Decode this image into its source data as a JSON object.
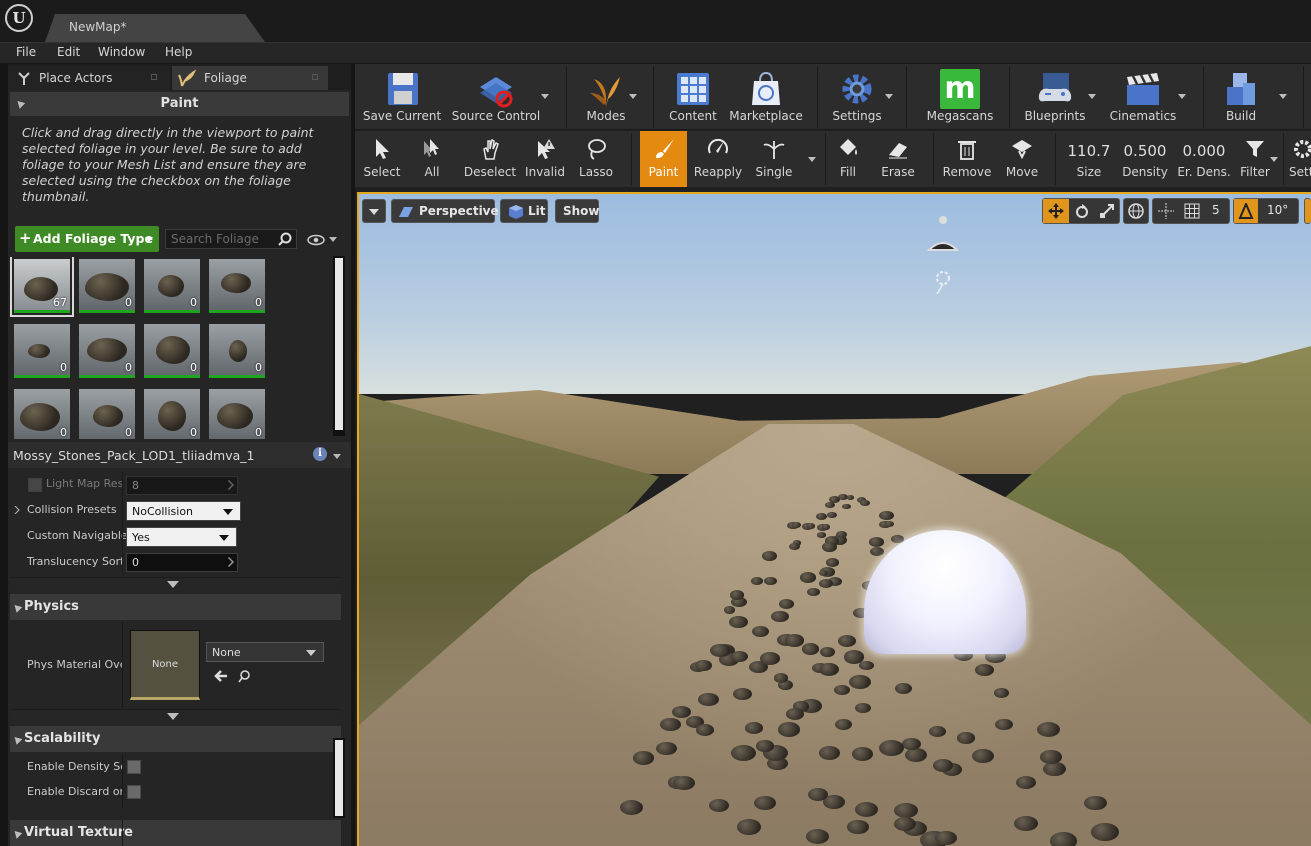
{
  "window": {
    "tab_title": "NewMap*"
  },
  "menu": {
    "file": "File",
    "edit": "Edit",
    "window": "Window",
    "help": "Help"
  },
  "left_tabs": {
    "place_actors": "Place Actors",
    "foliage": "Foliage"
  },
  "paint": {
    "header": "Paint",
    "help": "Click and drag directly in the viewport to paint selected foliage in your level. Be sure to add foliage to your Mesh List and ensure they are selected using the checkbox on the foliage thumbnail."
  },
  "foliage_list": {
    "add_button": "Add Foliage Type",
    "search_placeholder": "Search Foliage",
    "thumbnails": [
      {
        "count": "67"
      },
      {
        "count": "0"
      },
      {
        "count": "0"
      },
      {
        "count": "0"
      },
      {
        "count": "0"
      },
      {
        "count": "0"
      },
      {
        "count": "0"
      },
      {
        "count": "0"
      },
      {
        "count": "0"
      },
      {
        "count": "0"
      },
      {
        "count": "0"
      },
      {
        "count": "0"
      }
    ]
  },
  "details": {
    "object_name": "Mossy_Stones_Pack_LOD1_tliiadmva_1",
    "light_map_label": "Light Map Reso",
    "light_map_value": "8",
    "collision_label": "Collision Presets",
    "collision_value": "NoCollision",
    "navigable_label": "Custom Navigable",
    "navigable_value": "Yes",
    "translucency_label": "Translucency Sort",
    "translucency_value": "0",
    "physics_header": "Physics",
    "phys_material_label": "Phys Material Over",
    "phys_material_thumb": "None",
    "phys_material_value": "None",
    "scalability_header": "Scalability",
    "density_label": "Enable Density Sca",
    "discard_label": "Enable Discard on L",
    "virtual_texture_header": "Virtual Texture"
  },
  "main_toolbar": {
    "save_current": "Save Current",
    "source_control": "Source Control",
    "modes": "Modes",
    "content": "Content",
    "marketplace": "Marketplace",
    "settings": "Settings",
    "megascans": "Megascans",
    "blueprints": "Blueprints",
    "cinematics": "Cinematics",
    "build": "Build"
  },
  "foliage_toolbar": {
    "select": "Select",
    "all": "All",
    "deselect": "Deselect",
    "invalid": "Invalid",
    "lasso": "Lasso",
    "paint": "Paint",
    "reapply": "Reapply",
    "single": "Single",
    "fill": "Fill",
    "erase": "Erase",
    "remove": "Remove",
    "move": "Move",
    "size_value": "110.7",
    "size_label": "Size",
    "density_value": "0.500",
    "density_label": "Density",
    "erase_density_value": "0.000",
    "erase_density_label": "Er. Dens.",
    "filter": "Filter",
    "settings": "Setti"
  },
  "viewport": {
    "perspective": "Perspective",
    "lit": "Lit",
    "show": "Show",
    "grid_size": "5",
    "rotation_snap": "10°"
  },
  "colors": {
    "accent": "#e58a10",
    "add_button": "#3e8a24",
    "foliage_bar": "#1fa51f"
  }
}
